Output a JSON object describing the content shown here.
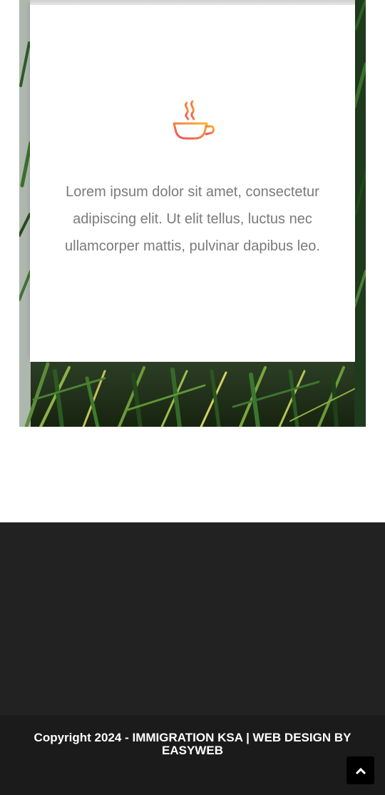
{
  "feature": {
    "icon": "coffee-cup-icon",
    "text": "Lorem ipsum dolor sit amet, consectetur adipiscing elit. Ut elit tellus, luctus nec ullamcorper mattis, pulvinar dapibus leo."
  },
  "footer": {
    "copyright": "Copyright 2024 - IMMIGRATION KSA | WEB DESIGN BY EASYWEB",
    "scroll_top_icon": "chevron-up-icon"
  },
  "colors": {
    "icon_gradient_start": "#ef4b63",
    "icon_gradient_end": "#f7b52c",
    "card_text": "#7a7a7a",
    "footer_bg": "#222222",
    "footer_bottom_bg": "#1b1b1b"
  }
}
